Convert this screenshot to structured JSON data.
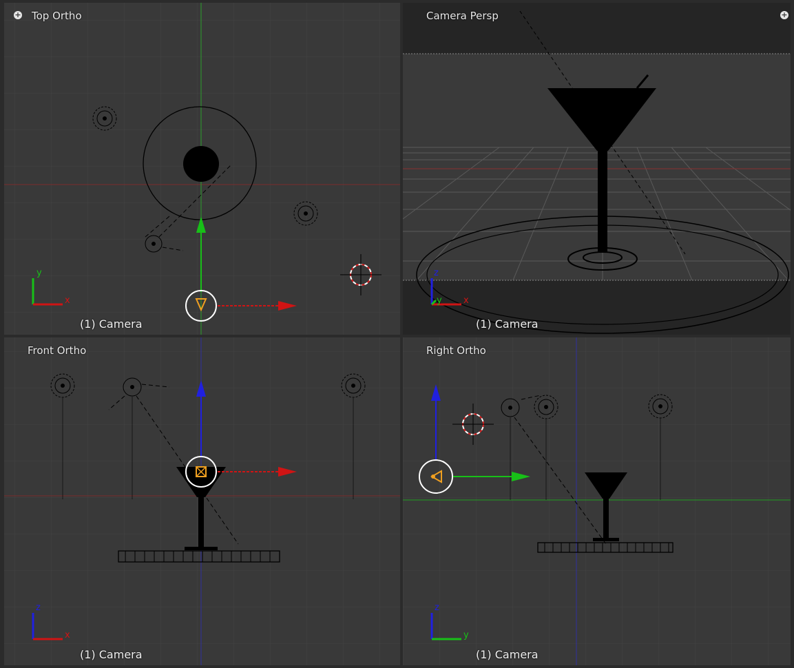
{
  "viewports": {
    "top": {
      "title": "Top Ortho",
      "object_label": "(1) Camera",
      "axis_h": "x",
      "axis_v": "y"
    },
    "camera": {
      "title": "Camera Persp",
      "object_label": "(1) Camera",
      "axis_h": "x",
      "axis_v": "z",
      "axis_d": "y"
    },
    "front": {
      "title": "Front Ortho",
      "object_label": "(1) Camera",
      "axis_h": "x",
      "axis_v": "z"
    },
    "right": {
      "title": "Right Ortho",
      "object_label": "(1) Camera",
      "axis_h": "y",
      "axis_v": "z"
    }
  },
  "colors": {
    "viewport_bg": "#393939",
    "grid": "#444444",
    "axis_x": "#d01414",
    "axis_y": "#18c018",
    "axis_z": "#2020e0",
    "selected": "#f0a020",
    "wire": "#000000"
  },
  "icons": {
    "viewport_menu": "plus-circle-icon"
  }
}
